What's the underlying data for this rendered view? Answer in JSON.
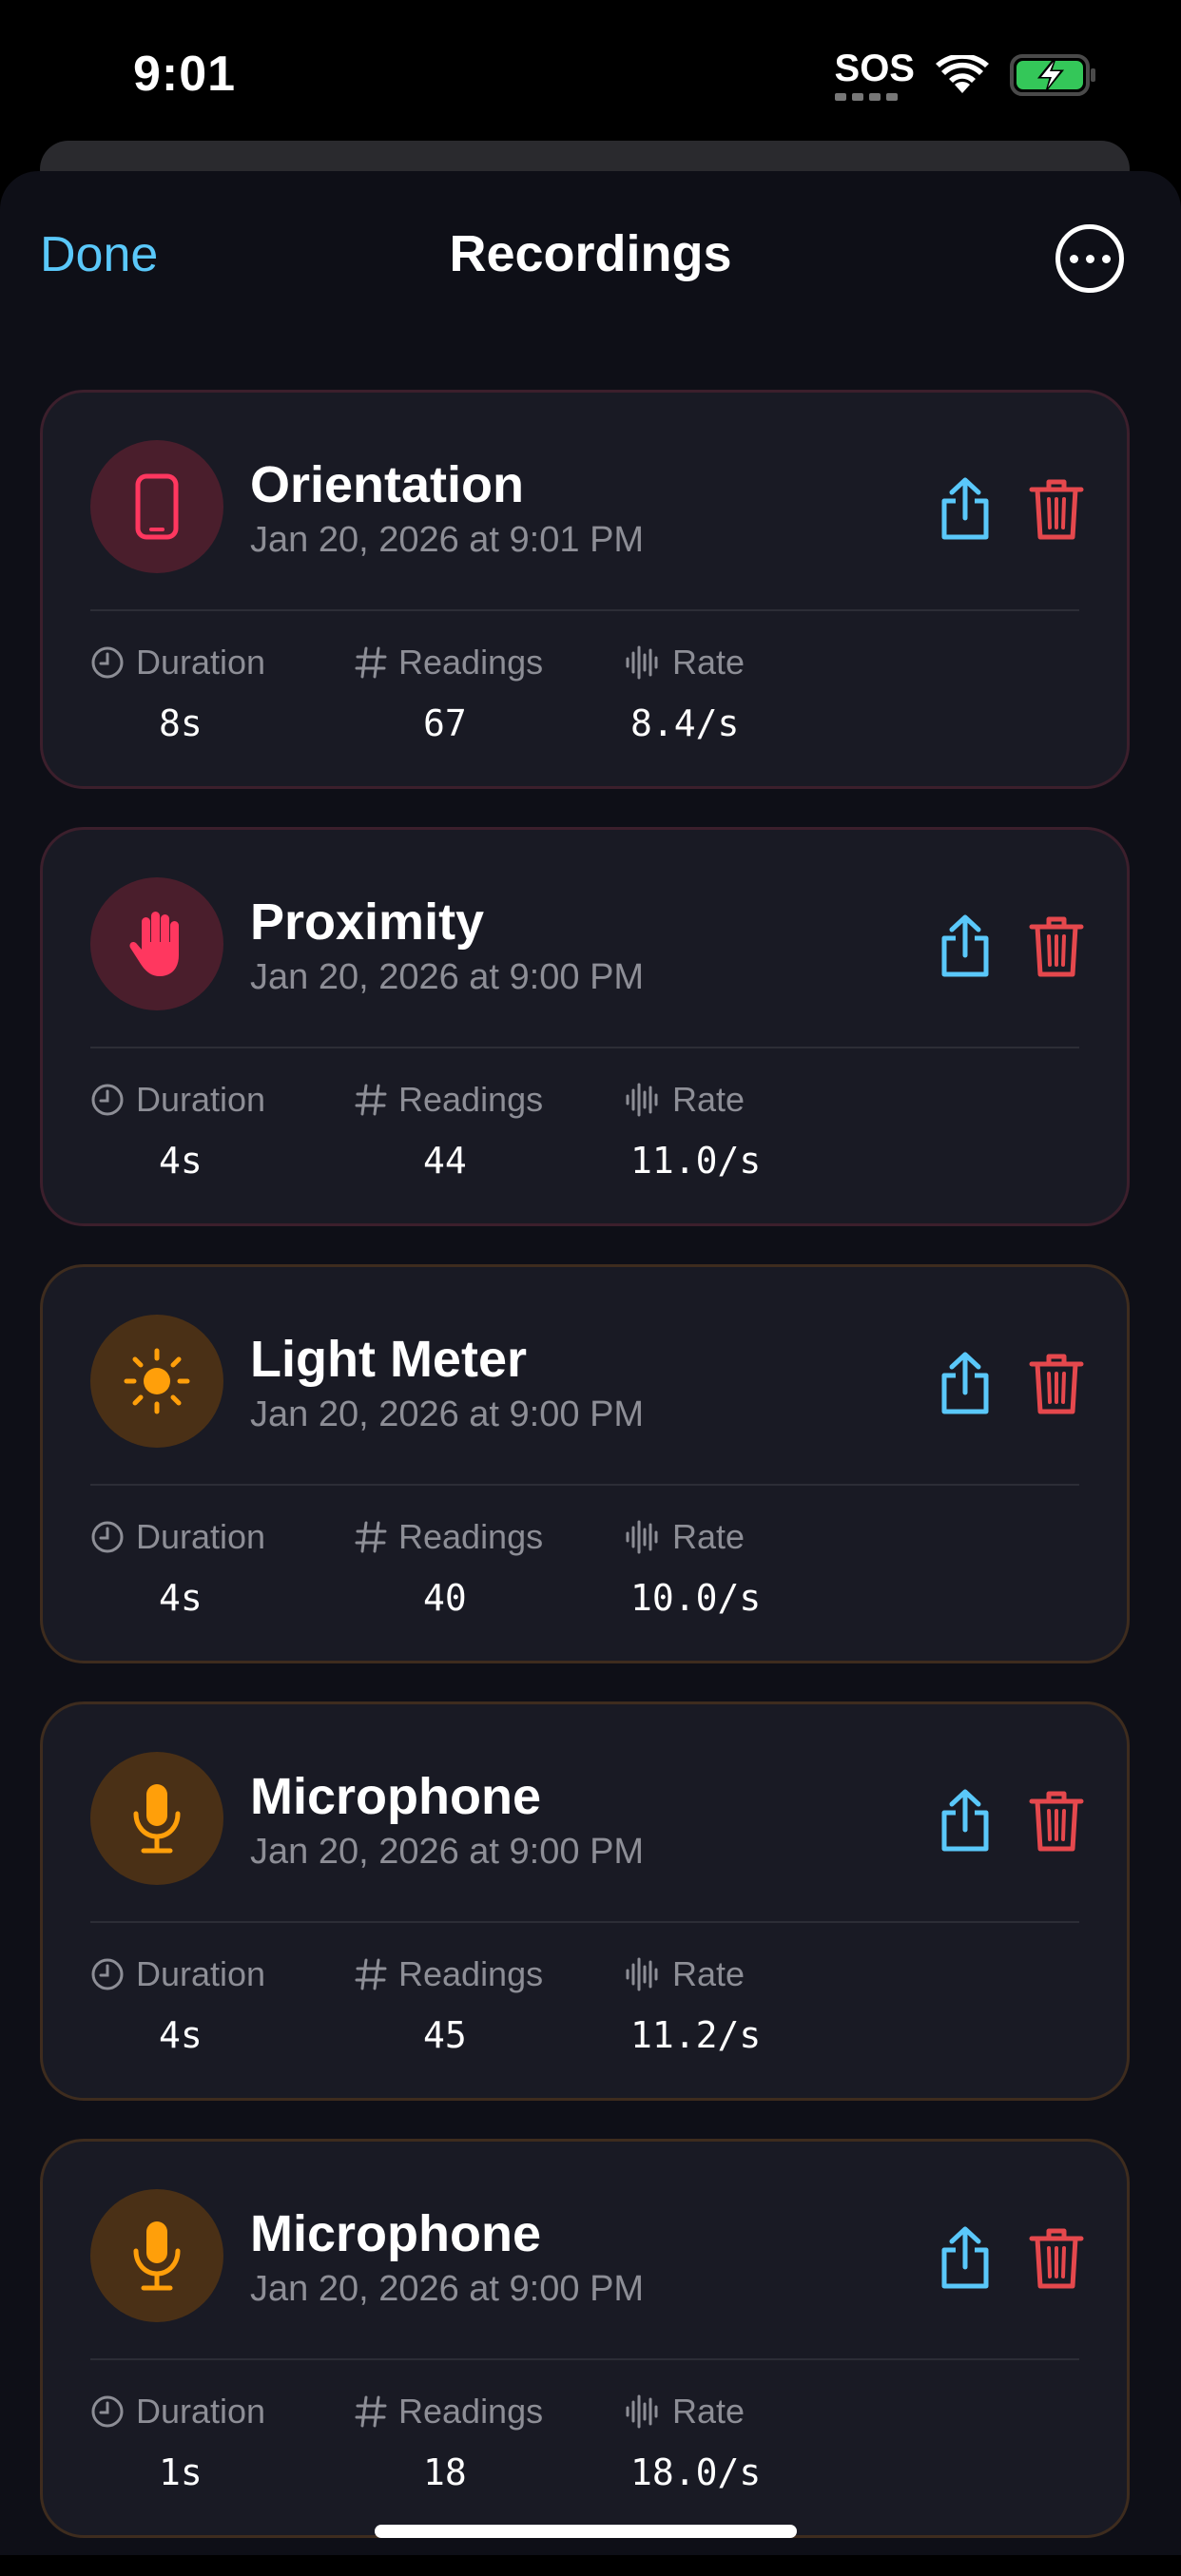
{
  "status_bar": {
    "time": "9:01",
    "sos": "SOS"
  },
  "nav": {
    "done_label": "Done",
    "title": "Recordings",
    "more_icon": "ellipsis-circle-icon"
  },
  "colors": {
    "accent_blue": "#5ac8fa",
    "delete_red": "#e5484d",
    "pink": "#ff375f",
    "orange": "#ff9f0a"
  },
  "recordings": [
    {
      "title": "Orientation",
      "date": "Jan 20, 2026 at 9:01 PM",
      "icon": "phone-icon",
      "duration_label": "Duration",
      "duration": "8s",
      "readings_label": "Readings",
      "readings": "67",
      "rate_label": "Rate",
      "rate": "8.4/s"
    },
    {
      "title": "Proximity",
      "date": "Jan 20, 2026 at 9:00 PM",
      "icon": "hand-icon",
      "duration_label": "Duration",
      "duration": "4s",
      "readings_label": "Readings",
      "readings": "44",
      "rate_label": "Rate",
      "rate": "11.0/s"
    },
    {
      "title": "Light Meter",
      "date": "Jan 20, 2026 at 9:00 PM",
      "icon": "sun-icon",
      "duration_label": "Duration",
      "duration": "4s",
      "readings_label": "Readings",
      "readings": "40",
      "rate_label": "Rate",
      "rate": "10.0/s"
    },
    {
      "title": "Microphone",
      "date": "Jan 20, 2026 at 9:00 PM",
      "icon": "microphone-icon",
      "duration_label": "Duration",
      "duration": "4s",
      "readings_label": "Readings",
      "readings": "45",
      "rate_label": "Rate",
      "rate": "11.2/s"
    },
    {
      "title": "Microphone",
      "date": "Jan 20, 2026 at 9:00 PM",
      "icon": "microphone-icon",
      "duration_label": "Duration",
      "duration": "1s",
      "readings_label": "Readings",
      "readings": "18",
      "rate_label": "Rate",
      "rate": "18.0/s"
    }
  ]
}
